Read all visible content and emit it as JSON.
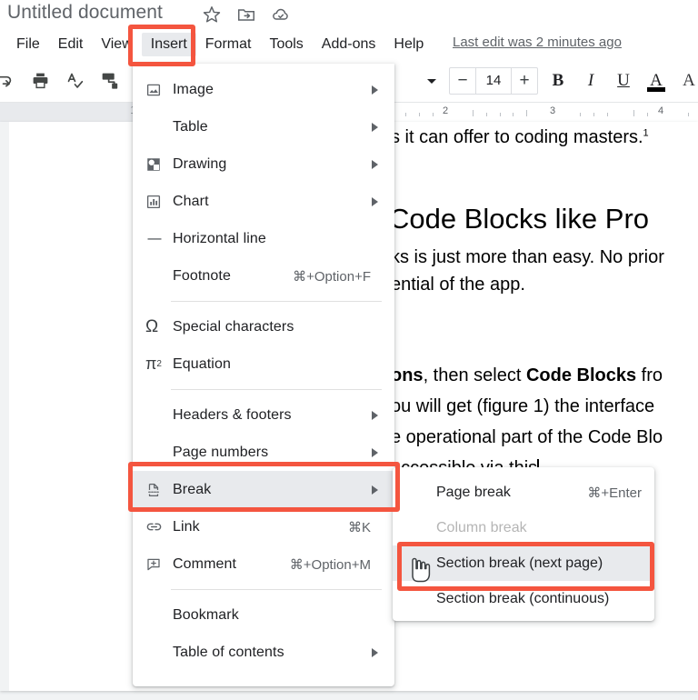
{
  "titlebar": {
    "document_title": "Untitled document",
    "icons": [
      {
        "name": "star-icon",
        "label": "Star"
      },
      {
        "name": "move-to-folder-icon",
        "label": "Move to folder"
      },
      {
        "name": "cloud-saved-icon",
        "label": "Saved to Drive"
      }
    ]
  },
  "menubar": {
    "items": [
      {
        "label": "File",
        "active": false
      },
      {
        "label": "Edit",
        "active": false
      },
      {
        "label": "View",
        "active": false
      },
      {
        "label": "Insert",
        "active": true
      },
      {
        "label": "Format",
        "active": false
      },
      {
        "label": "Tools",
        "active": false
      },
      {
        "label": "Add-ons",
        "active": false
      },
      {
        "label": "Help",
        "active": false
      }
    ],
    "last_edit": "Last edit was 2 minutes ago"
  },
  "toolbar": {
    "left_icons": [
      "redo-icon",
      "print-icon",
      "spelling-check-icon",
      "paint-format-icon"
    ],
    "font_dropdown_caret": "caret-down-icon",
    "font_size_decrease": "−",
    "font_size_value": "14",
    "font_size_increase": "+",
    "bold_label": "B",
    "italic_label": "I",
    "underline_label": "U",
    "text_color_label": "A"
  },
  "ruler": {
    "page_number": "1",
    "tick_numbers": [
      "2",
      "3",
      "4"
    ]
  },
  "document": {
    "line1": "s it can offer to coding masters.",
    "line1_sup": "1",
    "heading": "Code Blocks like Pro",
    "line2": "ks is just more than easy. No prior",
    "line3": "ential of the app.",
    "line4_a": "ons",
    "line4_b": ", then select ",
    "line4_c": "Code Blocks",
    "line4_d": " fro",
    "line5": "ou will get (figure 1) the interface",
    "line6": "e operational part of the Code Blo",
    "line7": "accessible via this"
  },
  "insert_menu": {
    "items": [
      {
        "icon": "image-icon",
        "label": "Image",
        "shortcut": "",
        "arrow": true,
        "highlighted": false,
        "divider_after": false
      },
      {
        "icon": "",
        "label": "Table",
        "shortcut": "",
        "arrow": true,
        "highlighted": false,
        "divider_after": false
      },
      {
        "icon": "drawing-icon",
        "label": "Drawing",
        "shortcut": "",
        "arrow": true,
        "highlighted": false,
        "divider_after": false
      },
      {
        "icon": "chart-icon",
        "label": "Chart",
        "shortcut": "",
        "arrow": true,
        "highlighted": false,
        "divider_after": false
      },
      {
        "icon": "horizontal-line-icon",
        "label": "Horizontal line",
        "shortcut": "",
        "arrow": false,
        "highlighted": false,
        "divider_after": false
      },
      {
        "icon": "",
        "label": "Footnote",
        "shortcut": "⌘+Option+F",
        "arrow": false,
        "highlighted": false,
        "divider_after": true
      },
      {
        "icon": "omega-icon",
        "label": "Special characters",
        "shortcut": "",
        "arrow": false,
        "highlighted": false,
        "divider_after": false
      },
      {
        "icon": "equation-icon",
        "label": "Equation",
        "shortcut": "",
        "arrow": false,
        "highlighted": false,
        "divider_after": true
      },
      {
        "icon": "",
        "label": "Headers & footers",
        "shortcut": "",
        "arrow": true,
        "highlighted": false,
        "divider_after": false
      },
      {
        "icon": "",
        "label": "Page numbers",
        "shortcut": "",
        "arrow": true,
        "highlighted": false,
        "divider_after": false
      },
      {
        "icon": "break-icon",
        "label": "Break",
        "shortcut": "",
        "arrow": true,
        "highlighted": true,
        "divider_after": false
      },
      {
        "icon": "link-icon",
        "label": "Link",
        "shortcut": "⌘K",
        "arrow": false,
        "highlighted": false,
        "divider_after": false
      },
      {
        "icon": "comment-icon",
        "label": "Comment",
        "shortcut": "⌘+Option+M",
        "arrow": false,
        "highlighted": false,
        "divider_after": true
      },
      {
        "icon": "",
        "label": "Bookmark",
        "shortcut": "",
        "arrow": false,
        "highlighted": false,
        "divider_after": false
      },
      {
        "icon": "",
        "label": "Table of contents",
        "shortcut": "",
        "arrow": true,
        "highlighted": false,
        "divider_after": false
      }
    ]
  },
  "break_submenu": {
    "items": [
      {
        "label": "Page break",
        "shortcut": "⌘+Enter",
        "disabled": false,
        "highlighted": false
      },
      {
        "label": "Column break",
        "shortcut": "",
        "disabled": true,
        "highlighted": false
      },
      {
        "label": "Section break (next page)",
        "shortcut": "",
        "disabled": false,
        "highlighted": true
      },
      {
        "label": "Section break (continuous)",
        "shortcut": "",
        "disabled": false,
        "highlighted": false
      }
    ]
  },
  "annotations": {
    "highlight_color": "#f4553f",
    "boxes": [
      {
        "name": "insert-menu-highlight-box"
      },
      {
        "name": "break-item-highlight-box"
      },
      {
        "name": "section-break-next-page-highlight-box"
      }
    ],
    "cursor": "pointing-hand-cursor"
  }
}
